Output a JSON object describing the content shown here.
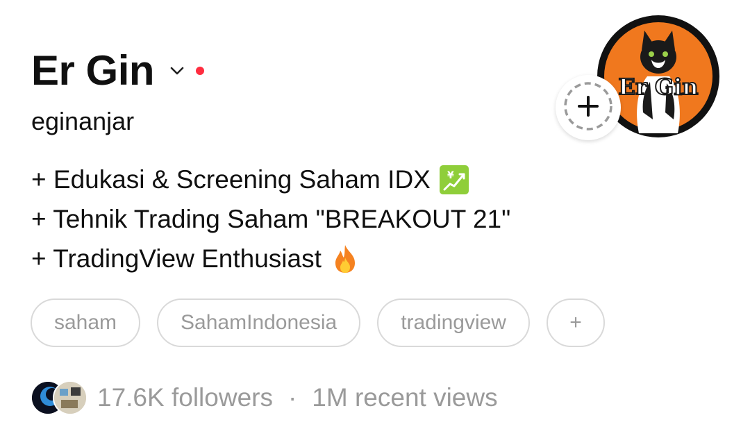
{
  "profile": {
    "display_name": "Er Gin",
    "username": "eginanjar",
    "avatar_text": "Er Gin",
    "status_dot_color": "#ff2d3f"
  },
  "bio": {
    "lines": [
      "+ Edukasi & Screening Saham IDX",
      "+ Tehnik Trading Saham \"BREAKOUT 21\"",
      "+ TradingView Enthusiast"
    ],
    "icons": [
      "chart-yen-emoji",
      "fire-emoji"
    ]
  },
  "tags": [
    "saham",
    "SahamIndonesia",
    "tradingview",
    "+"
  ],
  "stats": {
    "followers": "17.6K followers",
    "separator": "·",
    "views": "1M recent views"
  },
  "icons": {
    "chevron": "chevron-down-icon",
    "add_story": "add-story-icon"
  }
}
